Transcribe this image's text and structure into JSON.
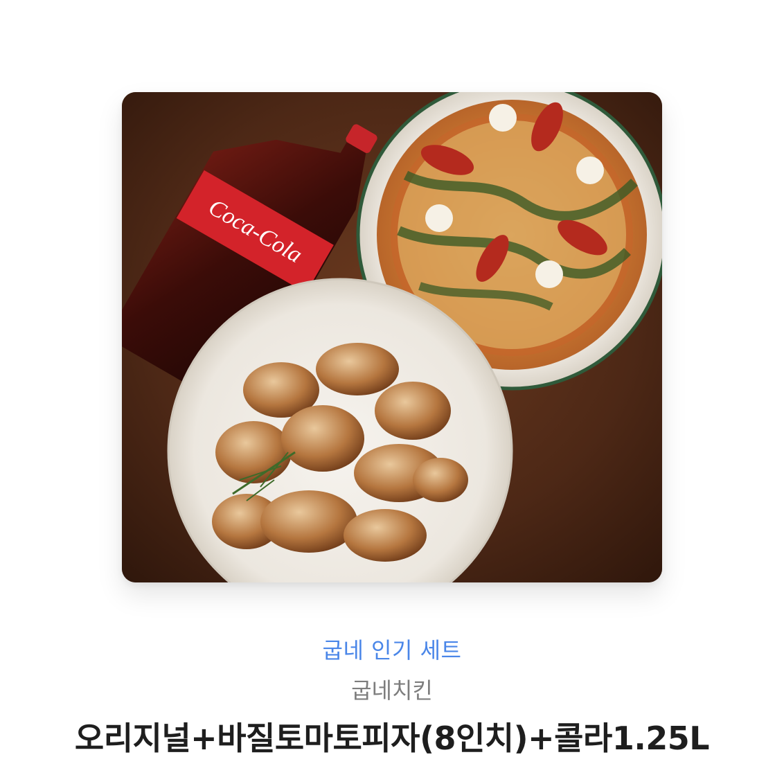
{
  "product": {
    "image_icon": "food-set-photo",
    "bottle_label": "Coca-Cola",
    "category": "굽네 인기 세트",
    "brand": "굽네치킨",
    "name": "오리지널+바질토마토피자(8인치)+콜라1.25L"
  },
  "colors": {
    "category": "#4a86e8",
    "brand": "#7d7d7d",
    "name": "#1e1e1e",
    "table": "#4a2716"
  }
}
